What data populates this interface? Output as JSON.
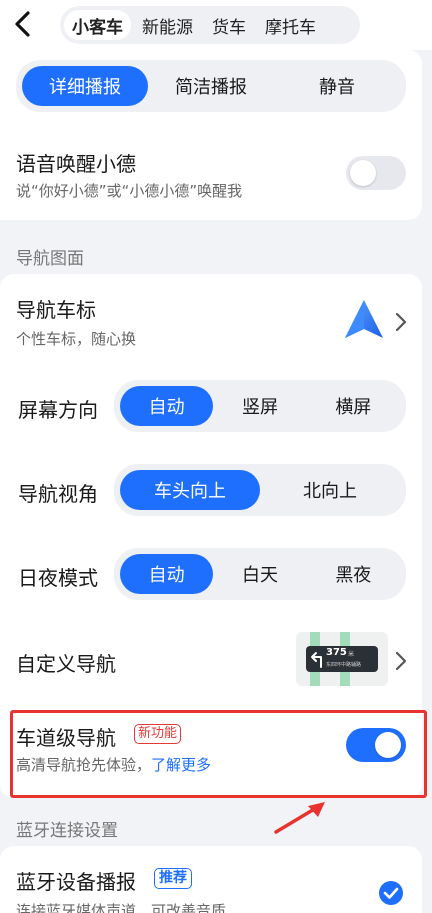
{
  "header": {
    "tabs": [
      {
        "label": "小客车",
        "active": true
      },
      {
        "label": "新能源",
        "active": false
      },
      {
        "label": "货车",
        "active": false
      },
      {
        "label": "摩托车",
        "active": false
      }
    ]
  },
  "broadcast": {
    "options": [
      "详细播报",
      "简洁播报",
      "静音"
    ],
    "selected": "详细播报"
  },
  "voice_wake": {
    "title": "语音唤醒小德",
    "subtitle": "说“你好小德”或“小德小德”唤醒我",
    "enabled": false
  },
  "sections": {
    "nav_display": "导航图面",
    "bluetooth": "蓝牙连接设置"
  },
  "nav_icon": {
    "title": "导航车标",
    "subtitle": "个性车标，随心换"
  },
  "screen_orientation": {
    "label": "屏幕方向",
    "options": [
      "自动",
      "竖屏",
      "横屏"
    ],
    "selected": "自动"
  },
  "nav_view": {
    "label": "导航视角",
    "options": [
      "车头向上",
      "北向上"
    ],
    "selected": "车头向上"
  },
  "day_night": {
    "label": "日夜模式",
    "options": [
      "自动",
      "白天",
      "黑夜"
    ],
    "selected": "自动"
  },
  "custom_nav": {
    "title": "自定义导航",
    "preview_distance": "375",
    "preview_unit": "米",
    "preview_road": "东四环中路辅路"
  },
  "lane_nav": {
    "title": "车道级导航",
    "badge": "新功能",
    "subtitle": "高清导航抢先体验，",
    "link": "了解更多",
    "enabled": true
  },
  "bluetooth_broadcast": {
    "title": "蓝牙设备播报",
    "badge": "推荐",
    "subtitle": "连接蓝牙媒体声道，可改善音质",
    "checked": true
  },
  "colors": {
    "accent": "#1f6fff",
    "highlight": "#e8332f"
  }
}
